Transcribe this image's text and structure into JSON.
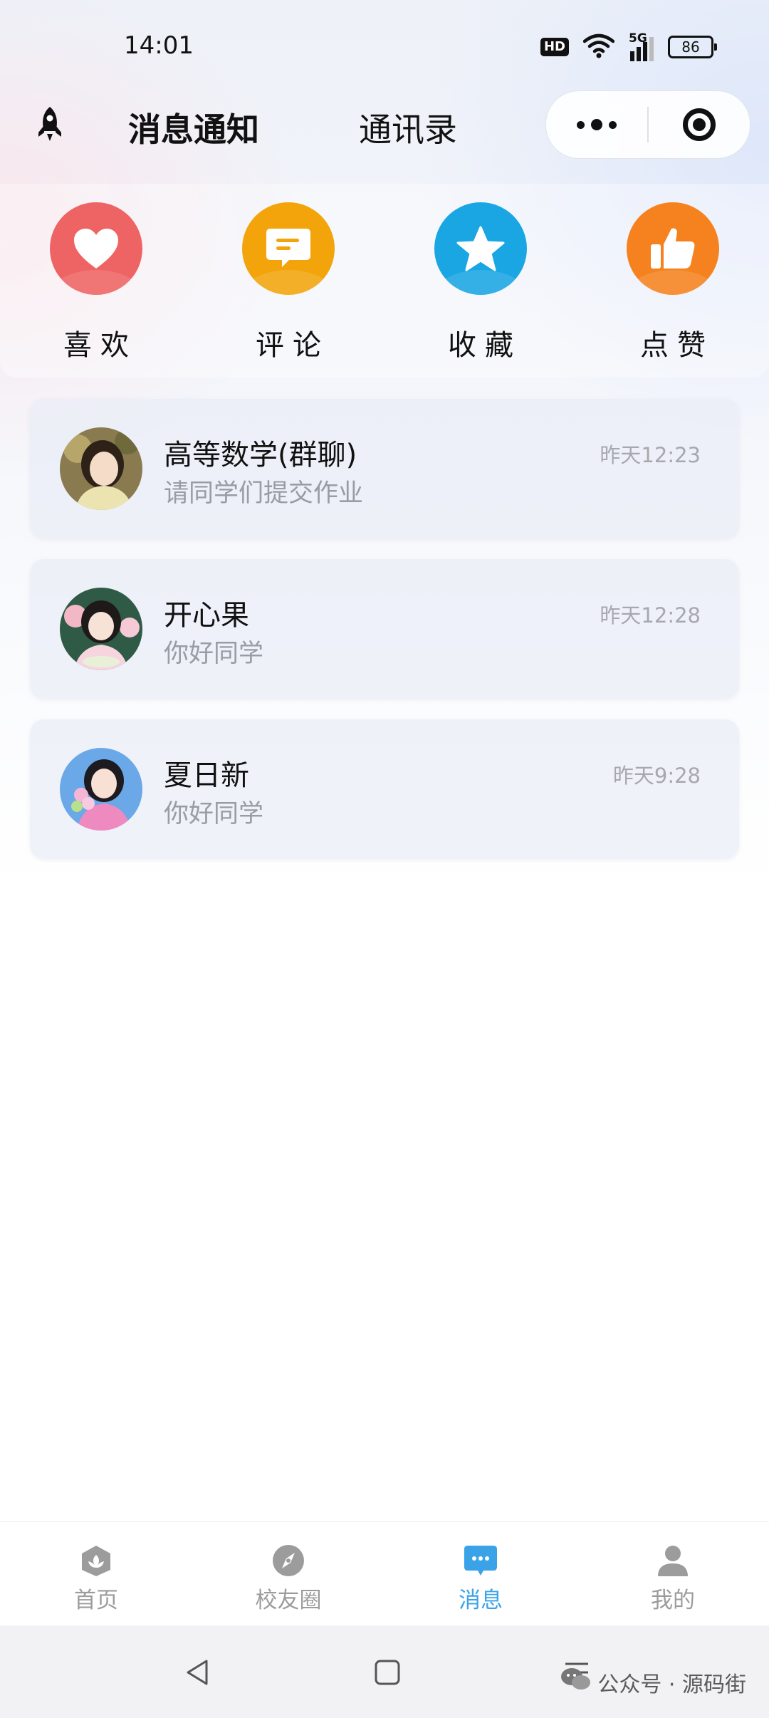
{
  "status_bar": {
    "time": "14:01",
    "hd": "HD",
    "network": "5G",
    "battery": "86"
  },
  "header": {
    "icon": "rocket-icon",
    "tabs": [
      {
        "label": "消息通知",
        "active": true
      },
      {
        "label": "通讯录",
        "active": false
      }
    ],
    "capsule": {
      "more_icon": "more-dots-icon",
      "close_icon": "target-icon"
    }
  },
  "quick_actions": [
    {
      "label": "喜欢",
      "icon": "heart-icon",
      "color": "#ee6363"
    },
    {
      "label": "评论",
      "icon": "comment-icon",
      "color": "#f2a40a"
    },
    {
      "label": "收藏",
      "icon": "star-icon",
      "color": "#1aa6e3"
    },
    {
      "label": "点赞",
      "icon": "thumbs-up-icon",
      "color": "#f5821f"
    }
  ],
  "conversations": [
    {
      "title": "高等数学(群聊)",
      "preview": "请同学们提交作业",
      "time": "昨天12:23"
    },
    {
      "title": "开心果",
      "preview": "你好同学",
      "time": "昨天12:28"
    },
    {
      "title": "夏日新",
      "preview": "你好同学",
      "time": "昨天9:28"
    }
  ],
  "bottom_nav": [
    {
      "label": "首页",
      "icon": "home-icon",
      "active": false
    },
    {
      "label": "校友圈",
      "icon": "compass-icon",
      "active": false
    },
    {
      "label": "消息",
      "icon": "message-icon",
      "active": true
    },
    {
      "label": "我的",
      "icon": "profile-icon",
      "active": false
    }
  ],
  "colors": {
    "active_tab": "#3aa3e8",
    "inactive_tab": "#9c9c9c"
  },
  "watermark": "公众号 · 源码街"
}
